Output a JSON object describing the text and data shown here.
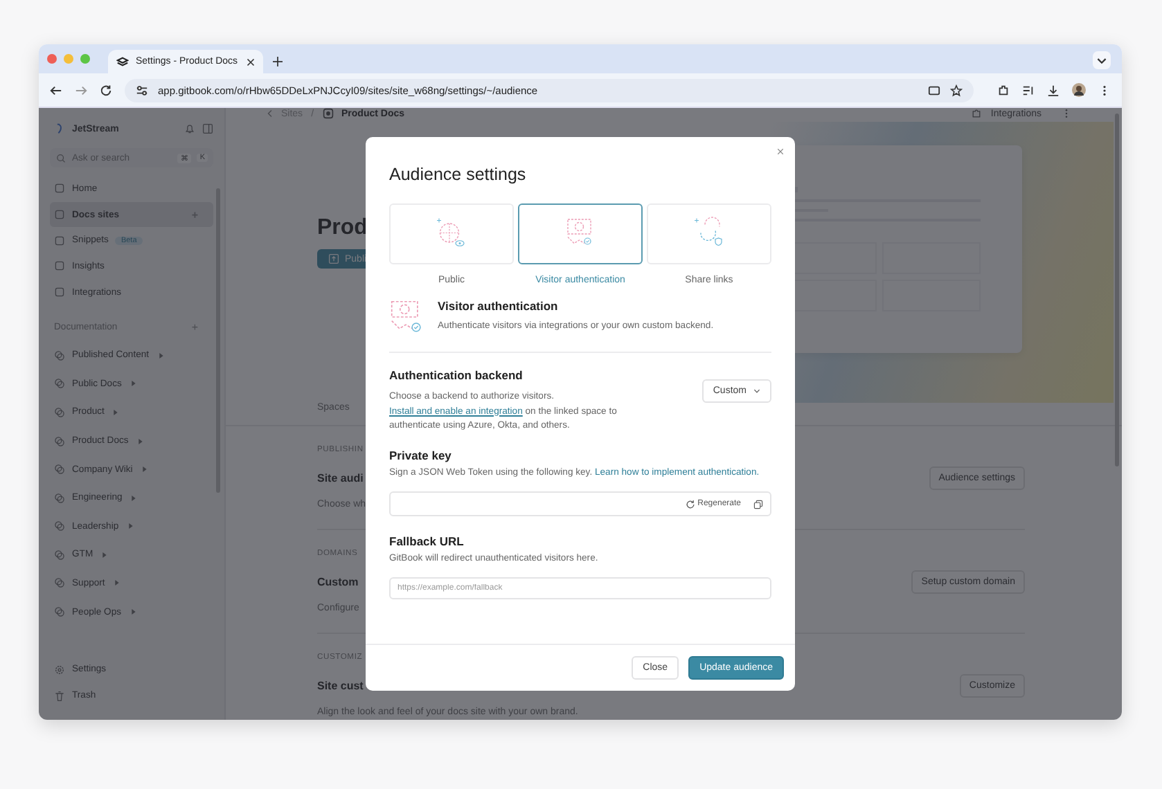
{
  "browser": {
    "tab_title": "Settings - Product Docs",
    "url": "app.gitbook.com/o/rHbw65DDeLxPNJCcyI09/sites/site_w68ng/settings/~/audience"
  },
  "sidebar": {
    "workspace": "JetStream",
    "search_placeholder": "Ask or search",
    "shortcut": [
      "⌘",
      "K"
    ],
    "nav": [
      {
        "label": "Home",
        "selected": false
      },
      {
        "label": "Docs sites",
        "selected": true,
        "action": "+"
      },
      {
        "label": "Snippets",
        "selected": false,
        "badge": "Beta"
      },
      {
        "label": "Insights",
        "selected": false
      },
      {
        "label": "Integrations",
        "selected": false
      }
    ],
    "section_title": "Documentation",
    "section_action": "+",
    "spaces": [
      "Published Content",
      "Public Docs",
      "Product",
      "Product Docs",
      "Company Wiki",
      "Engineering",
      "Leadership",
      "GTM",
      "Support",
      "People Ops"
    ],
    "footer": [
      "Settings",
      "Trash"
    ]
  },
  "main": {
    "breadcrumb": [
      "Sites",
      "Product Docs"
    ],
    "breadcrumb_separator": "/",
    "header_action": "Integrations",
    "title": "Prod",
    "publish_button": "Publi",
    "tabs": [
      "Spaces"
    ],
    "sections": [
      {
        "heading": "PUBLISHIN",
        "title": "Site audi",
        "description": "Choose wh",
        "action": "Audience settings"
      },
      {
        "heading": "DOMAINS",
        "title": "Custom",
        "description": "Configure",
        "action": "Setup custom domain"
      },
      {
        "heading": "CUSTOMIZ",
        "title": "Site cust",
        "description": "Align the look and feel of your docs site with your own brand.",
        "action": "Customize"
      }
    ]
  },
  "modal": {
    "title": "Audience settings",
    "options": [
      {
        "kind": "globe",
        "label": "Public",
        "selected": false
      },
      {
        "kind": "shield",
        "label": "Visitor authentication",
        "selected": true
      },
      {
        "kind": "link",
        "label": "Share links",
        "selected": false
      }
    ],
    "info": {
      "title": "Visitor authentication",
      "description": "Authenticate visitors via integrations or your own custom backend."
    },
    "backend": {
      "title": "Authentication backend",
      "description": "Choose a backend to authorize visitors.",
      "link": "Install and enable an integration",
      "description_after": "on the linked space to authenticate using Azure, Okta, and others.",
      "select": "Custom"
    },
    "private_key": {
      "title": "Private key",
      "description": "Sign a JSON Web Token using the following key.",
      "link": "Learn how to implement authentication.",
      "regenerate": "Regenerate"
    },
    "fallback": {
      "title": "Fallback URL",
      "description": "GitBook will redirect unauthenticated visitors here.",
      "placeholder": "https://example.com/fallback"
    },
    "buttons": [
      "Close",
      "Update audience"
    ]
  }
}
